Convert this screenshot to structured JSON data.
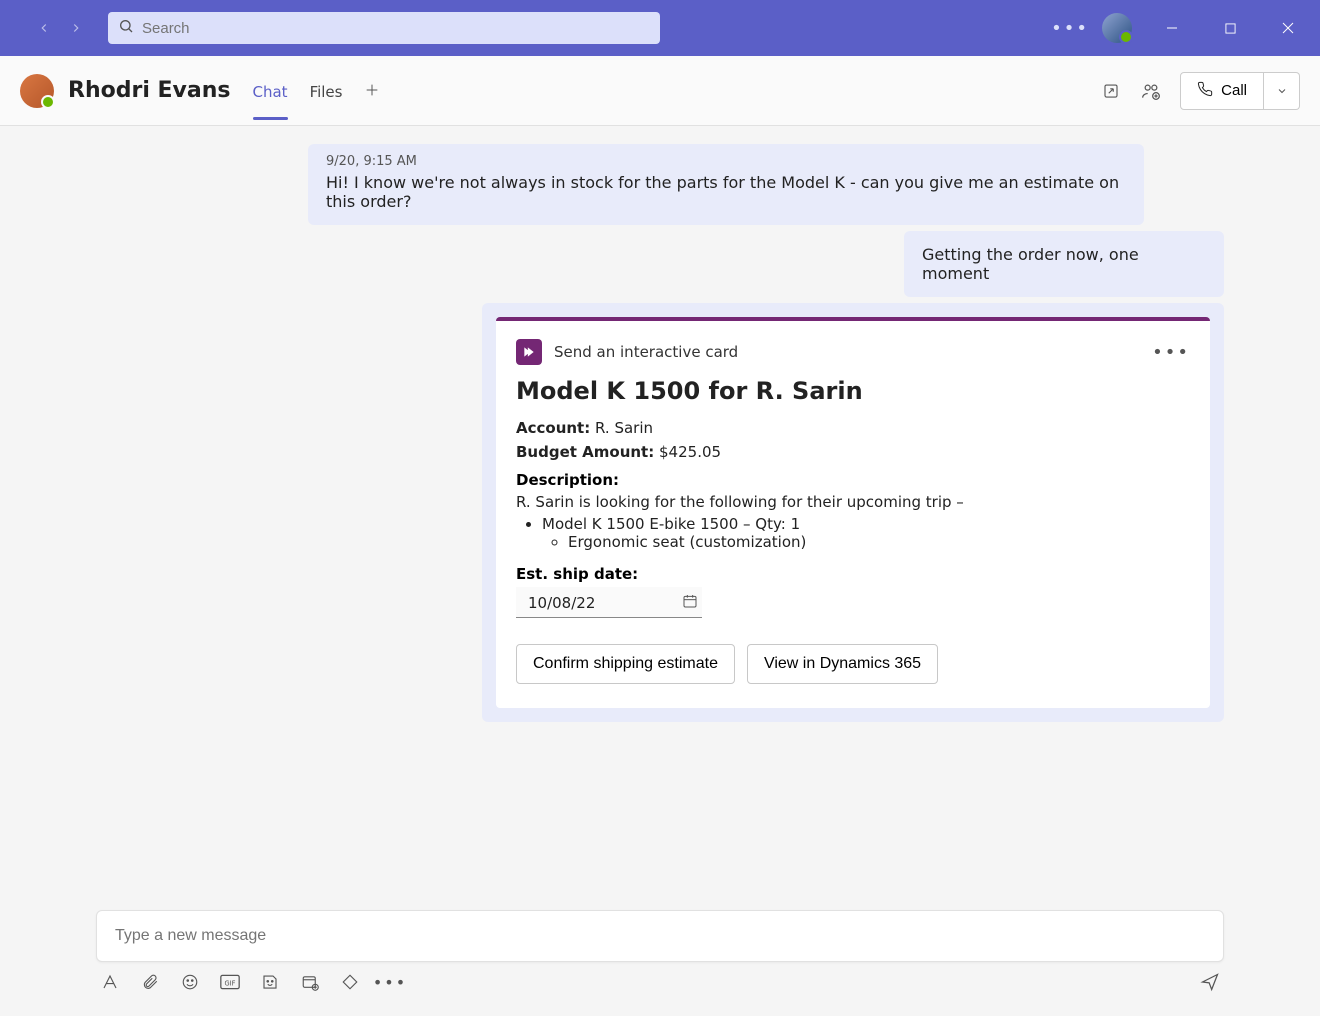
{
  "titlebar": {
    "search_placeholder": "Search"
  },
  "chat_header": {
    "name": "Rhodri Evans",
    "tabs": {
      "chat": "Chat",
      "files": "Files"
    },
    "call_label": "Call"
  },
  "messages": {
    "incoming": {
      "timestamp": "9/20, 9:15 AM",
      "body": "Hi! I know we're not always in stock for the parts for the Model K - can you give me an estimate on this order?"
    },
    "outgoing": {
      "body": "Getting the order now, one moment"
    }
  },
  "card": {
    "app_label": "Send an interactive card",
    "title": "Model K 1500 for R. Sarin",
    "account_label": "Account:",
    "account_value": "R. Sarin",
    "budget_label": "Budget Amount:",
    "budget_value": "$425.05",
    "description_label": "Description:",
    "description_text": "R. Sarin is looking for the following for their upcoming trip –",
    "item1": "Model K 1500 E-bike 1500 – Qty: 1",
    "item1_sub": "Ergonomic seat (customization)",
    "ship_label": "Est. ship date:",
    "ship_value": "10/08/22",
    "btn_confirm": "Confirm shipping estimate",
    "btn_view": "View in Dynamics 365"
  },
  "compose": {
    "placeholder": "Type a new message"
  }
}
